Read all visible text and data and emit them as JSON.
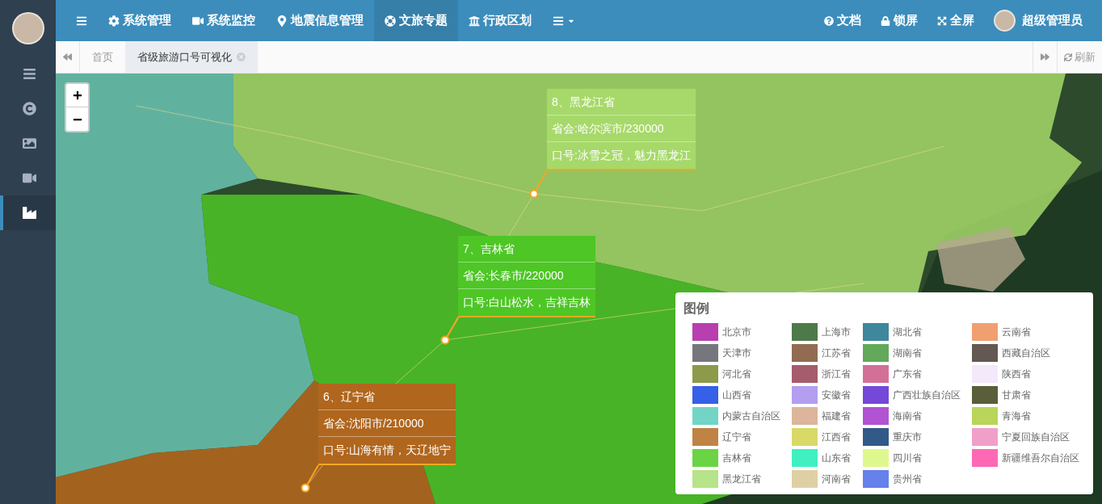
{
  "sidebar": {
    "items": [
      {
        "kind": "menu",
        "selected": false
      },
      {
        "kind": "copyright",
        "selected": false
      },
      {
        "kind": "image",
        "selected": false
      },
      {
        "kind": "video",
        "selected": false
      },
      {
        "kind": "chart",
        "selected": true
      }
    ]
  },
  "nav": {
    "items": [
      {
        "kind": "menu",
        "selected": false
      },
      {
        "kind": "gear",
        "label": "系统管理",
        "selected": false
      },
      {
        "kind": "video",
        "label": "系统监控",
        "selected": false
      },
      {
        "kind": "pin",
        "label": "地震信息管理",
        "selected": false
      },
      {
        "kind": "lifering",
        "label": "文旅专题",
        "selected": true
      },
      {
        "kind": "bank",
        "label": "行政区划",
        "selected": false
      },
      {
        "kind": "more",
        "selected": false
      }
    ],
    "right": [
      {
        "kind": "help",
        "label": "文档"
      },
      {
        "kind": "lock",
        "label": "锁屏"
      },
      {
        "kind": "expand",
        "label": "全屏"
      },
      {
        "kind": "user",
        "label": "超级管理员"
      }
    ]
  },
  "tabs": [
    {
      "label": "首页",
      "selected": false,
      "closable": false
    },
    {
      "label": "省级旅游口号可视化",
      "selected": true,
      "closable": true
    }
  ],
  "refresh": "刷新",
  "map": {
    "popups": [
      {
        "title": "8、黑龙江省",
        "capital": "省会:哈尔滨市/230000",
        "slogan": "口号:冰雪之冠，魅力黑龙江",
        "color": "#a6d96a"
      },
      {
        "title": "7、吉林省",
        "capital": "省会:长春市/220000",
        "slogan": "口号:白山松水，吉祥吉林",
        "color": "#4ec626"
      },
      {
        "title": "6、辽宁省",
        "capital": "省会:沈阳市/210000",
        "slogan": "口号:山海有情，天辽地宁",
        "color": "#b0661d"
      }
    ],
    "legend": {
      "title": "图例",
      "items": [
        {
          "label": "北京市",
          "color": "#b73fb0"
        },
        {
          "label": "天津市",
          "color": "#76767e"
        },
        {
          "label": "河北省",
          "color": "#8c9a4a"
        },
        {
          "label": "山西省",
          "color": "#3660e8"
        },
        {
          "label": "内蒙古自治区",
          "color": "#72d5c5"
        },
        {
          "label": "辽宁省",
          "color": "#bf8444"
        },
        {
          "label": "吉林省",
          "color": "#6ad444"
        },
        {
          "label": "黑龙江省",
          "color": "#b7e38a"
        },
        {
          "label": "上海市",
          "color": "#4e7a4a"
        },
        {
          "label": "江苏省",
          "color": "#926c52"
        },
        {
          "label": "浙江省",
          "color": "#a55c6c"
        },
        {
          "label": "安徽省",
          "color": "#b39ef0"
        },
        {
          "label": "福建省",
          "color": "#dcb59c"
        },
        {
          "label": "江西省",
          "color": "#d9d968"
        },
        {
          "label": "山东省",
          "color": "#40f0c0"
        },
        {
          "label": "河南省",
          "color": "#dfd0a4"
        },
        {
          "label": "湖北省",
          "color": "#3f879c"
        },
        {
          "label": "湖南省",
          "color": "#62a95a"
        },
        {
          "label": "广东省",
          "color": "#d37098"
        },
        {
          "label": "广西壮族自治区",
          "color": "#7448d8"
        },
        {
          "label": "海南省",
          "color": "#b153d2"
        },
        {
          "label": "重庆市",
          "color": "#325a88"
        },
        {
          "label": "四川省",
          "color": "#dff88e"
        },
        {
          "label": "贵州省",
          "color": "#6680ec"
        },
        {
          "label": "云南省",
          "color": "#f0a070"
        },
        {
          "label": "西藏自治区",
          "color": "#635852"
        },
        {
          "label": "陕西省",
          "color": "#f3e9fa"
        },
        {
          "label": "甘肃省",
          "color": "#5a5e3a"
        },
        {
          "label": "青海省",
          "color": "#b9d55a"
        },
        {
          "label": "宁夏回族自治区",
          "color": "#f0a0c8"
        },
        {
          "label": "新疆维吾尔自治区",
          "color": "#fd69b4"
        }
      ]
    }
  }
}
